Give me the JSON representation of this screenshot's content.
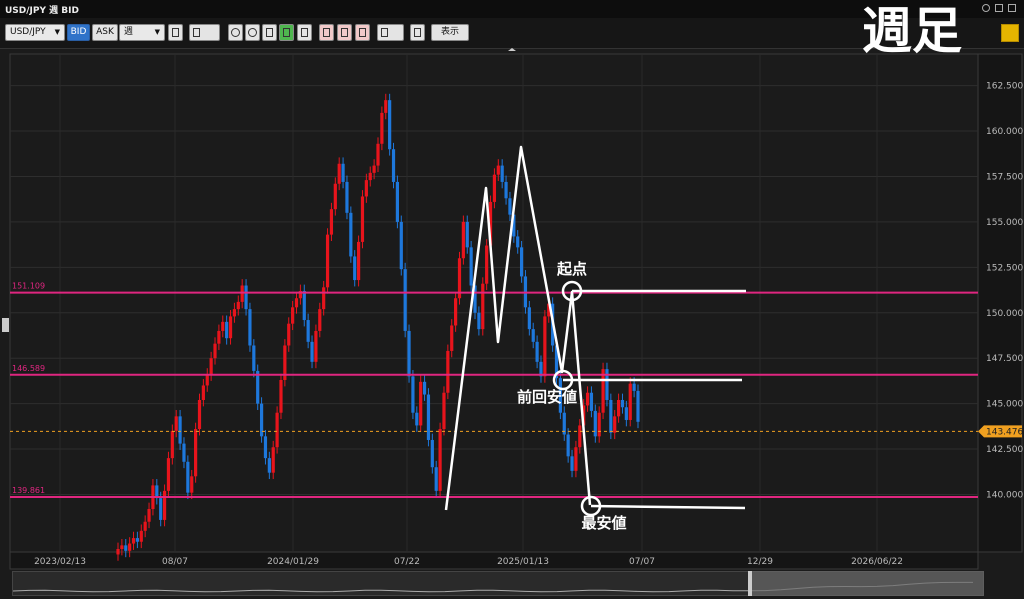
{
  "window": {
    "title": "USD/JPY 週 BID",
    "big_title": "週足"
  },
  "toolbar": {
    "pair": "USD/JPY",
    "bid_label": "BID",
    "ask_label": "ASK",
    "period": "週",
    "display_label": "表示"
  },
  "colors": {
    "up": "#e8141c",
    "down": "#1e78dc",
    "hline": "#e02680",
    "annotation": "#ffffff",
    "current_price": "#f0a020",
    "bg": "#1b1b1b"
  },
  "chart_data": {
    "type": "candlestick",
    "ylim": [
      137.0,
      163.8
    ],
    "yticks": [
      "162.500",
      "160.000",
      "157.500",
      "155.000",
      "152.500",
      "150.000",
      "147.500",
      "145.000",
      "142.500",
      "140.000"
    ],
    "xticks": [
      "2023/02/13",
      "08/07",
      "2024/01/29",
      "07/22",
      "2025/01/13",
      "07/07",
      "12/29",
      "2026/06/22"
    ],
    "horizontal_lines": [
      {
        "label": "151.109",
        "value": 151.109
      },
      {
        "label": "146.589",
        "value": 146.589
      },
      {
        "label": "139.861",
        "value": 139.861
      }
    ],
    "current_price": {
      "label": "143.476",
      "value": 143.476
    },
    "annotations": [
      {
        "text": "起点"
      },
      {
        "text": "前回安値"
      },
      {
        "text": "最安値"
      }
    ],
    "candles_close": [
      137.0,
      137.2,
      136.9,
      137.3,
      137.6,
      137.4,
      138.0,
      138.5,
      139.2,
      140.5,
      139.8,
      138.6,
      140.2,
      142.0,
      143.5,
      144.3,
      142.8,
      141.8,
      140.1,
      141.0,
      143.6,
      145.2,
      146.0,
      146.6,
      147.5,
      148.3,
      149.0,
      149.5,
      148.6,
      149.8,
      150.2,
      150.6,
      151.5,
      150.2,
      148.2,
      146.8,
      145.0,
      143.2,
      142.0,
      141.2,
      142.6,
      144.5,
      146.3,
      148.2,
      149.4,
      150.3,
      150.8,
      151.2,
      149.6,
      148.4,
      147.3,
      149.0,
      150.2,
      151.4,
      154.3,
      155.7,
      157.1,
      158.2,
      157.2,
      155.5,
      153.1,
      151.8,
      153.9,
      156.4,
      157.3,
      157.7,
      158.1,
      159.3,
      161.0,
      161.7,
      159.0,
      157.2,
      155.0,
      152.4,
      149.0,
      146.5,
      144.5,
      143.8,
      146.2,
      145.5,
      143.0,
      141.5,
      140.2,
      143.6,
      145.6,
      147.9,
      149.3,
      150.8,
      153.0,
      155.0,
      153.6,
      151.5,
      150.0,
      149.1,
      151.6,
      153.7,
      156.1,
      157.6,
      158.1,
      157.2,
      156.3,
      155.4,
      154.2,
      153.6,
      152.0,
      150.3,
      149.1,
      148.4,
      147.3,
      146.5,
      149.8,
      150.5,
      148.2,
      146.4,
      144.5,
      143.3,
      142.1,
      141.3,
      142.6,
      143.8,
      144.9,
      145.6,
      144.6,
      143.2,
      144.5,
      146.9,
      145.2,
      143.4,
      144.3,
      145.2,
      144.8,
      144.1,
      146.1,
      145.7,
      144.0
    ]
  }
}
